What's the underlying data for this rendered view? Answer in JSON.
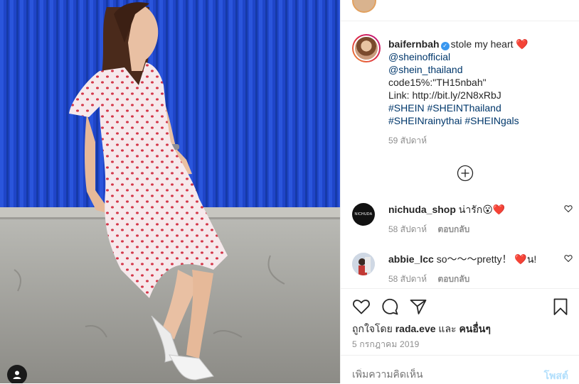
{
  "photo": {
    "alt_icon": "user-tag-icon"
  },
  "post": {
    "username": "baifernbah",
    "verified": true,
    "caption_intro": "stole my heart",
    "caption_emoji": "❤️",
    "mention_1": "@sheinofficial",
    "mention_2": "@shein_thailand",
    "code_line": "code15%:\"TH15nbah\"",
    "link_line": "Link: http://bit.ly/2N8xRbJ",
    "hashtags_line_1": "#SHEIN #SHEINThailand",
    "hashtags_line_2": "#SHEINrainythai #SHEINgals",
    "caption_time": "59 สัปดาห์"
  },
  "comments": [
    {
      "username": "nichuda_shop",
      "text": "น่ารัก😮❤️",
      "avatar_label": "NICHUDA",
      "time": "58 สัปดาห์",
      "reply": "ตอบกลับ"
    },
    {
      "username": "abbie_lcc",
      "text": "so～～～pretty！ ❤️น!",
      "time": "58 สัปดาห์",
      "reply": "ตอบกลับ"
    }
  ],
  "actions": {
    "like_icon": "heart-icon",
    "comment_icon": "comment-icon",
    "share_icon": "share-icon",
    "save_icon": "bookmark-icon"
  },
  "likes": {
    "prefix": "ถูกใจโดย",
    "liker": "rada.eve",
    "joiner": "และ",
    "others": "คนอื่นๆ"
  },
  "post_date": "5 กรกฎาคม 2019",
  "comment_box": {
    "placeholder": "เพิ่มความคิดเห็น",
    "post_label": "โพสต์"
  },
  "colors": {
    "link": "#00376b",
    "muted": "#8e8e8e",
    "verified": "#3897f0",
    "post_disabled": "#b2dffc"
  }
}
